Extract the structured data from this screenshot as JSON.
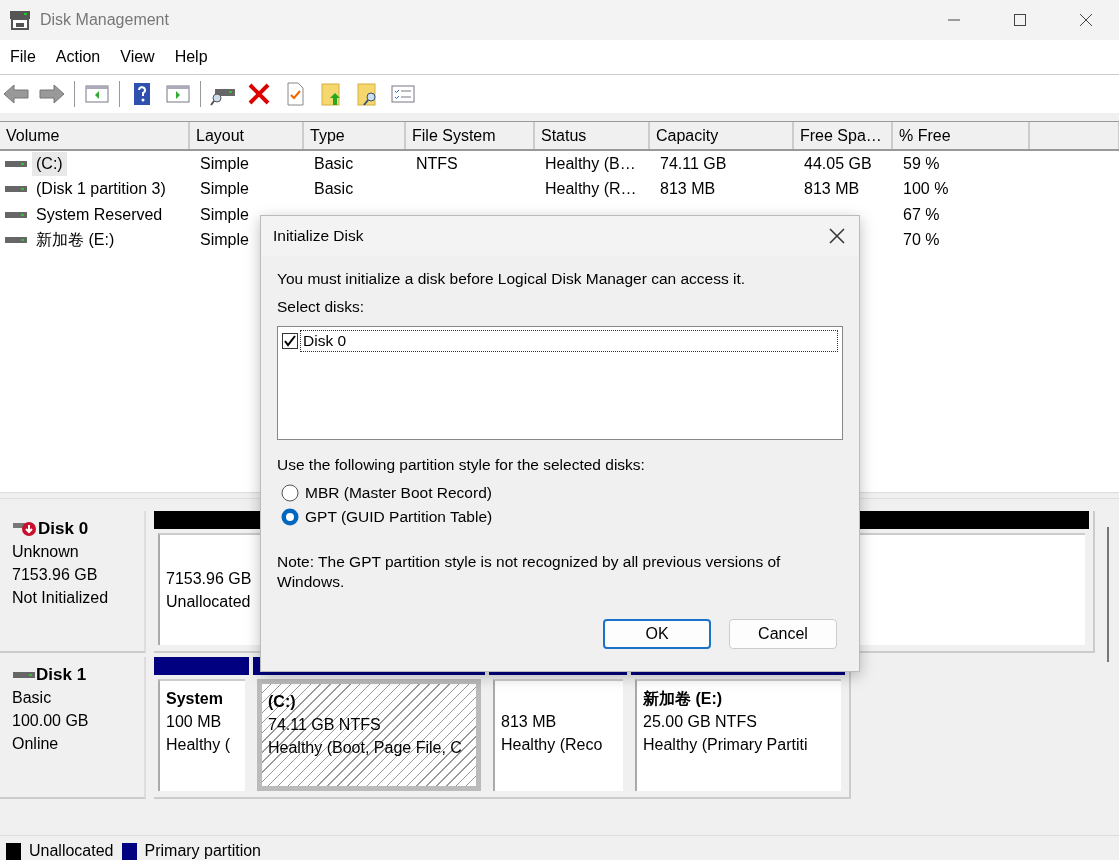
{
  "window": {
    "title": "Disk Management"
  },
  "menu": [
    "File",
    "Action",
    "View",
    "Help"
  ],
  "volume_list": {
    "columns": [
      "Volume",
      "Layout",
      "Type",
      "File System",
      "Status",
      "Capacity",
      "Free Spa…",
      "% Free"
    ],
    "rows": [
      {
        "selected": true,
        "cells": [
          "(C:)",
          "Simple",
          "Basic",
          "NTFS",
          "Healthy (B…",
          "74.11 GB",
          "44.05 GB",
          "59 %"
        ]
      },
      {
        "selected": false,
        "cells": [
          "(Disk 1 partition 3)",
          "Simple",
          "Basic",
          "",
          "Healthy (R…",
          "813 MB",
          "813 MB",
          "100 %"
        ]
      },
      {
        "selected": false,
        "cells": [
          "System Reserved",
          "Simple",
          "",
          "",
          "",
          "",
          "",
          "67 %"
        ]
      },
      {
        "selected": false,
        "cells": [
          "新加卷 (E:)",
          "Simple",
          "",
          "",
          "",
          "",
          "",
          "70 %"
        ]
      }
    ]
  },
  "disks": [
    {
      "kind": "not_initialized",
      "name": "Disk 0",
      "lines": [
        "Unknown",
        "7153.96 GB",
        "Not Initialized"
      ],
      "partitions": [
        {
          "kind": "unallocated",
          "selected": false,
          "lines": [
            "7153.96 GB",
            "Unallocated"
          ]
        }
      ]
    },
    {
      "kind": "online",
      "name": "Disk 1",
      "lines": [
        "Basic",
        "100.00 GB",
        "Online"
      ],
      "partitions": [
        {
          "kind": "primary",
          "selected": false,
          "title": "System",
          "lines": [
            "100 MB",
            "Healthy ("
          ]
        },
        {
          "kind": "primary",
          "selected": true,
          "title": "(C:)",
          "lines": [
            "74.11 GB NTFS",
            "Healthy (Boot, Page File, C"
          ]
        },
        {
          "kind": "primary",
          "selected": false,
          "lines": [
            "813 MB",
            "Healthy (Reco"
          ]
        },
        {
          "kind": "primary",
          "selected": false,
          "title": "新加卷 (E:)",
          "lines": [
            "25.00 GB NTFS",
            "Healthy (Primary Partiti"
          ]
        }
      ]
    }
  ],
  "legend": [
    {
      "label": "Unallocated",
      "color": "#000000"
    },
    {
      "label": "Primary partition",
      "color": "#000080"
    }
  ],
  "dialog": {
    "title": "Initialize Disk",
    "message": "You must initialize a disk before Logical Disk Manager can access it.",
    "select_label": "Select disks:",
    "disks": [
      {
        "label": "Disk 0",
        "checked": true
      }
    ],
    "style_label": "Use the following partition style for the selected disks:",
    "options": [
      {
        "label": "MBR (Master Boot Record)",
        "selected": false
      },
      {
        "label": "GPT (GUID Partition Table)",
        "selected": true
      }
    ],
    "note": "Note: The GPT partition style is not recognized by all previous versions of Windows.",
    "buttons": [
      {
        "label": "OK",
        "default": true
      },
      {
        "label": "Cancel",
        "default": false
      }
    ]
  }
}
